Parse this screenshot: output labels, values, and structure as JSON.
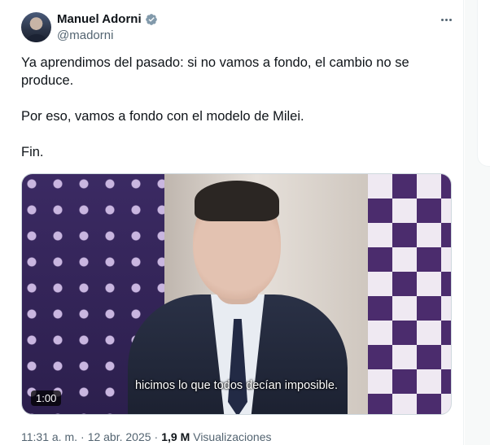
{
  "author": {
    "display_name": "Manuel Adorni",
    "handle": "@madorni",
    "verified_icon": "verified-badge-icon",
    "verified_color": "#829aab"
  },
  "tweet": {
    "paragraphs": [
      "Ya aprendimos del pasado: si no vamos a fondo, el cambio no se produce.",
      "Por eso, vamos a fondo con el modelo de Milei.",
      "Fin."
    ]
  },
  "video": {
    "subtitle": "hicimos lo que todos decían imposible.",
    "duration": "1:00"
  },
  "meta": {
    "time": "11:31 a. m.",
    "separator": "·",
    "date": "12 abr. 2025",
    "separator2": "·",
    "views_count": "1,9 M",
    "views_label": "Visualizaciones"
  },
  "colors": {
    "text_primary": "#0f1419",
    "text_secondary": "#536471",
    "border": "#cfd9de"
  }
}
